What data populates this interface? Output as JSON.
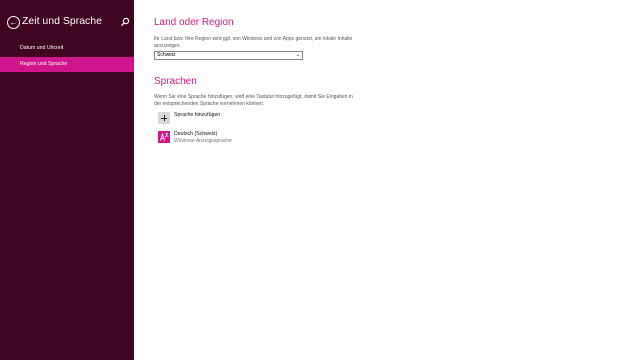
{
  "sidebar": {
    "title": "Zeit und Sprache",
    "items": [
      {
        "label": "Datum und Uhrzeit",
        "active": false
      },
      {
        "label": "Region und Sprache",
        "active": true
      }
    ]
  },
  "region": {
    "heading": "Land oder Region",
    "description": "Ihr Land bzw. Ihre Region wird ggf. von Windows und von Apps genutzt, um lokale Inhalte anzuzeigen.",
    "selected": "Schweiz"
  },
  "languages": {
    "heading": "Sprachen",
    "description": "Wenn Sie eine Sprache hinzufügen, wird eine Tastatur hinzugefügt, damit Sie Eingaben in der entsprechenden Sprache vornehmen können.",
    "add_label": "Sprache hinzufügen",
    "items": [
      {
        "name": "Deutsch (Schweiz)",
        "sub": "Windows-Anzeigesprache"
      }
    ]
  },
  "colors": {
    "accent": "#d1158c",
    "sidebar_bg": "#3f0521"
  }
}
